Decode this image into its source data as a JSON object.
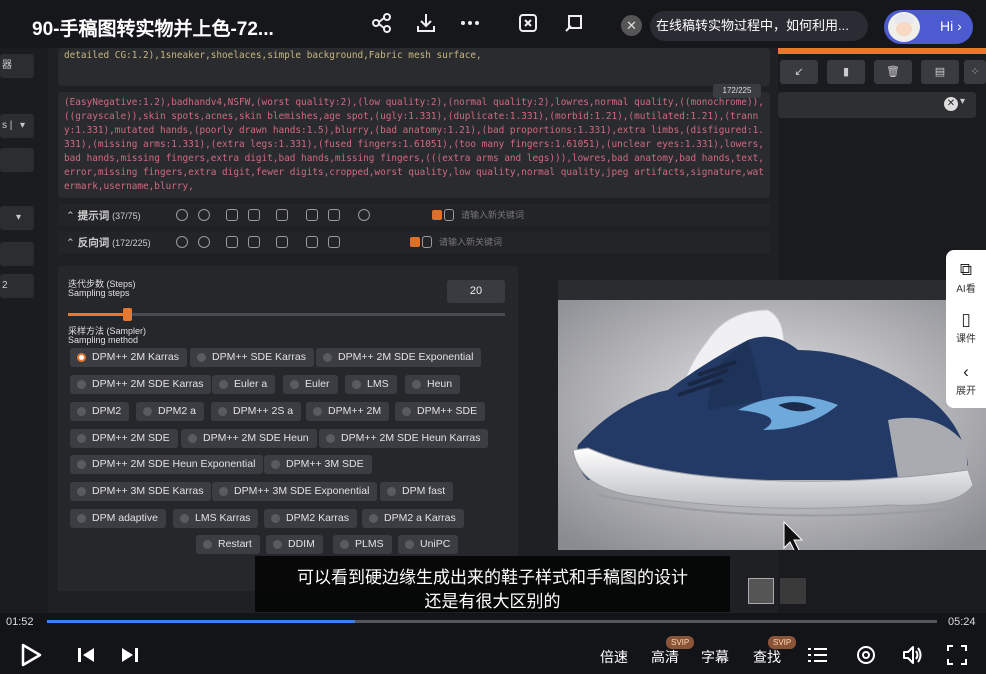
{
  "window": {
    "title": "90-手稿图转实物并上色-72...",
    "question": "在线稿转实物过程中，如何利用...",
    "hi": "Hi",
    "close_glyph": "✕"
  },
  "left_sidebar": {
    "items": [
      "器",
      "s |",
      "",
      "",
      "",
      "2"
    ]
  },
  "prompt": {
    "positive_text": "detailed CG:1.2),1sneaker,shoelaces,simple background,Fabric mesh surface,",
    "negative_count": "172/225",
    "negative_text": "(EasyNegative:1.2),badhandv4,NSFW,(worst quality:2),(low quality:2),(normal quality:2),lowres,normal quality,((monochrome)),((grayscale)),skin spots,acnes,skin blemishes,age spot,(ugly:1.331),(duplicate:1.331),(morbid:1.21),(mutilated:1.21),(tranny:1.331),mutated hands,(poorly drawn hands:1.5),blurry,(bad anatomy:1.21),(bad proportions:1.331),extra limbs,(disfigured:1.331),(missing arms:1.331),(extra legs:1.331),(fused fingers:1.61051),(too many fingers:1.61051),(unclear eyes:1.331),lowers,bad hands,missing fingers,extra digit,bad hands,missing fingers,(((extra arms and legs))),lowres,bad anatomy,bad hands,text,error,missing fingers,extra digit,fewer digits,cropped,worst quality,low quality,normal quality,jpeg artifacts,signature,watermark,username,blurry,",
    "positive_row_label": "提示词",
    "positive_row_count": "(37/75)",
    "negative_row_label": "反向词",
    "negative_row_count": "(172/225)",
    "keyword_placeholder": "请输入新关键词"
  },
  "settings": {
    "steps_label": "迭代步数 (Steps)",
    "steps_sub": "Sampling steps",
    "steps_value": "20",
    "steps_level": 0.14,
    "sampler_label": "采样方法 (Sampler)",
    "sampler_sub": "Sampling method",
    "samplers": [
      "DPM++ 2M Karras",
      "DPM++ SDE Karras",
      "DPM++ 2M SDE Exponential",
      "DPM++ 2M SDE Karras",
      "Euler a",
      "Euler",
      "LMS",
      "Heun",
      "DPM2",
      "DPM2 a",
      "DPM++ 2S a",
      "DPM++ 2M",
      "DPM++ SDE",
      "DPM++ 2M SDE",
      "DPM++ 2M SDE Heun",
      "DPM++ 2M SDE Heun Karras",
      "DPM++ 2M SDE Heun Exponential",
      "DPM++ 3M SDE",
      "DPM++ 3M SDE Karras",
      "DPM++ 3M SDE Exponential",
      "DPM fast",
      "DPM adaptive",
      "LMS Karras",
      "DPM2 Karras",
      "DPM2 a Karras",
      "Restart",
      "DDIM",
      "PLMS",
      "UniPC"
    ],
    "selected_sampler": "DPM++ 2M Karras"
  },
  "side_menu": [
    {
      "label": "AI看",
      "icon": "ai-view-icon"
    },
    {
      "label": "课件",
      "icon": "courseware-icon"
    },
    {
      "label": "展开",
      "icon": "chevron-left-icon"
    }
  ],
  "subtitles": [
    "可以看到硬边缘生成出来的鞋子样式和手稿图的设计",
    "还是有很大区别的"
  ],
  "player": {
    "current_time": "01:52",
    "total_time": "05:24",
    "progress": 0.346,
    "speed": "倍速",
    "quality": "高清",
    "subtitle_btn": "字幕",
    "search": "查找",
    "svip": "SVIP"
  },
  "colors": {
    "accent": "#e6782f",
    "progress": "#3d7ef0",
    "hi_pill": "#4c5bd0"
  }
}
